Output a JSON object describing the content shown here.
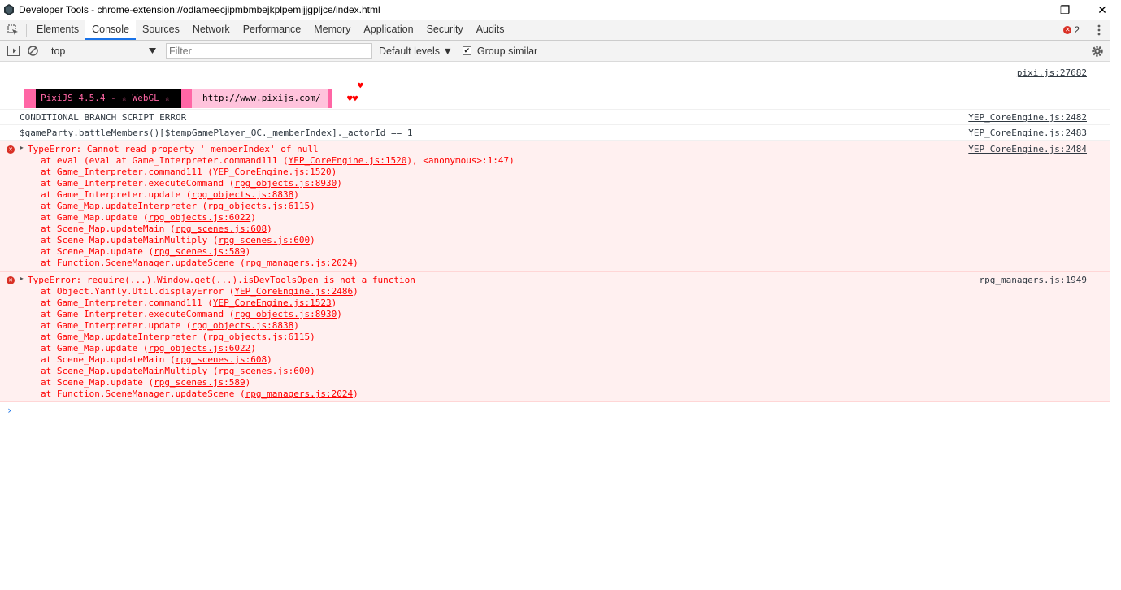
{
  "window": {
    "title": "Developer Tools - chrome-extension://odlameecjipmbmbejkplpemijjgpljce/index.html",
    "minimize": "—",
    "restore": "❐",
    "close": "✕"
  },
  "tabs": [
    "Elements",
    "Console",
    "Sources",
    "Network",
    "Performance",
    "Memory",
    "Application",
    "Security",
    "Audits"
  ],
  "active_tab": "Console",
  "error_count": "2",
  "toolbar": {
    "context": "top",
    "filter_placeholder": "Filter",
    "levels": "Default levels ▼",
    "group_similar": "Group similar",
    "group_similar_checked": "✔"
  },
  "console": {
    "pixi": {
      "source": "pixi.js:27682",
      "version_text": "PixiJS 4.5.4 - ☆ WebGL ☆",
      "url": "http://www.pixijs.com/",
      "hearts": "♥♥",
      "heart_top": "♥"
    },
    "log1": {
      "text": "CONDITIONAL BRANCH SCRIPT ERROR",
      "source": "YEP_CoreEngine.js:2482"
    },
    "log2": {
      "text": "$gameParty.battleMembers()[$tempGamePlayer_OC._memberIndex]._actorId == 1",
      "source": "YEP_CoreEngine.js:2483"
    },
    "error1": {
      "source": "YEP_CoreEngine.js:2484",
      "head": "TypeError: Cannot read property '_memberIndex' of null",
      "stack": [
        {
          "pre": "at eval (eval at Game_Interpreter.command111 (",
          "link": "YEP_CoreEngine.js:1520",
          "post": "), <anonymous>:1:47)"
        },
        {
          "pre": "at Game_Interpreter.command111 (",
          "link": "YEP_CoreEngine.js:1520",
          "post": ")"
        },
        {
          "pre": "at Game_Interpreter.executeCommand (",
          "link": "rpg_objects.js:8930",
          "post": ")"
        },
        {
          "pre": "at Game_Interpreter.update (",
          "link": "rpg_objects.js:8838",
          "post": ")"
        },
        {
          "pre": "at Game_Map.updateInterpreter (",
          "link": "rpg_objects.js:6115",
          "post": ")"
        },
        {
          "pre": "at Game_Map.update (",
          "link": "rpg_objects.js:6022",
          "post": ")"
        },
        {
          "pre": "at Scene_Map.updateMain (",
          "link": "rpg_scenes.js:608",
          "post": ")"
        },
        {
          "pre": "at Scene_Map.updateMainMultiply (",
          "link": "rpg_scenes.js:600",
          "post": ")"
        },
        {
          "pre": "at Scene_Map.update (",
          "link": "rpg_scenes.js:589",
          "post": ")"
        },
        {
          "pre": "at Function.SceneManager.updateScene (",
          "link": "rpg_managers.js:2024",
          "post": ")"
        }
      ]
    },
    "error2": {
      "source": "rpg_managers.js:1949",
      "head": "TypeError: require(...).Window.get(...).isDevToolsOpen is not a function",
      "stack": [
        {
          "pre": "at Object.Yanfly.Util.displayError (",
          "link": "YEP_CoreEngine.js:2486",
          "post": ")"
        },
        {
          "pre": "at Game_Interpreter.command111 (",
          "link": "YEP_CoreEngine.js:1523",
          "post": ")"
        },
        {
          "pre": "at Game_Interpreter.executeCommand (",
          "link": "rpg_objects.js:8930",
          "post": ")"
        },
        {
          "pre": "at Game_Interpreter.update (",
          "link": "rpg_objects.js:8838",
          "post": ")"
        },
        {
          "pre": "at Game_Map.updateInterpreter (",
          "link": "rpg_objects.js:6115",
          "post": ")"
        },
        {
          "pre": "at Game_Map.update (",
          "link": "rpg_objects.js:6022",
          "post": ")"
        },
        {
          "pre": "at Scene_Map.updateMain (",
          "link": "rpg_scenes.js:608",
          "post": ")"
        },
        {
          "pre": "at Scene_Map.updateMainMultiply (",
          "link": "rpg_scenes.js:600",
          "post": ")"
        },
        {
          "pre": "at Scene_Map.update (",
          "link": "rpg_scenes.js:589",
          "post": ")"
        },
        {
          "pre": "at Function.SceneManager.updateScene (",
          "link": "rpg_managers.js:2024",
          "post": ")"
        }
      ]
    },
    "prompt": "›"
  },
  "colors": {
    "error_text": "#ff0000",
    "error_bg": "#fff0f0",
    "accent": "#1a73e8",
    "pixi_pink": "#ff66a5"
  },
  "icons": [
    "devtools-app-icon",
    "inspect-element-icon",
    "kebab-menu-icon",
    "sidebar-toggle-icon",
    "clear-console-icon",
    "settings-gear-icon",
    "error-icon",
    "expand-triangle-icon"
  ]
}
